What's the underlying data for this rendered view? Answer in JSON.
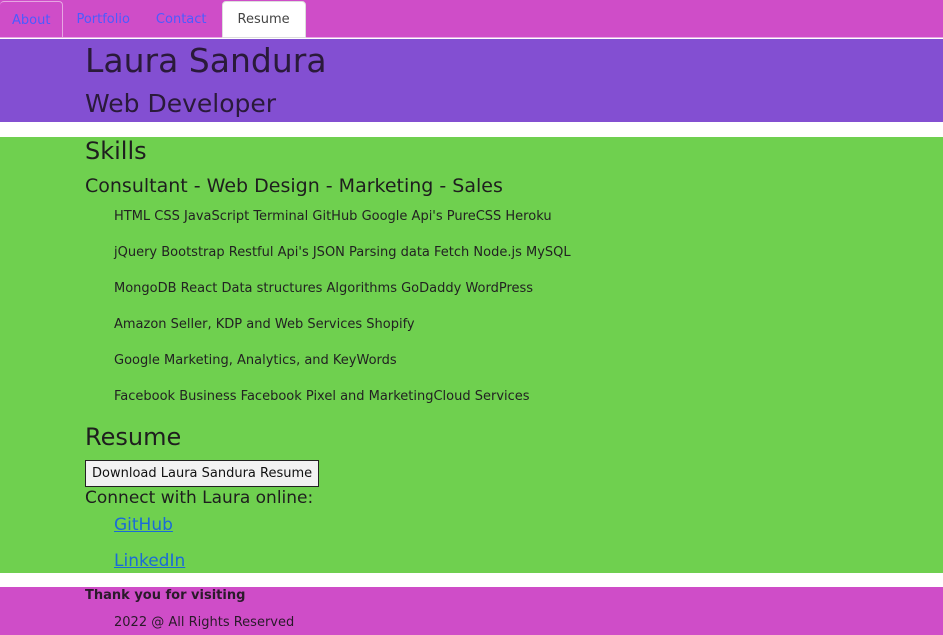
{
  "nav": {
    "tabs": [
      {
        "label": "About"
      },
      {
        "label": "Portfolio"
      },
      {
        "label": "Contact"
      },
      {
        "label": "Resume"
      }
    ],
    "active": "Resume"
  },
  "header": {
    "name": "Laura Sandura",
    "role": "Web Developer"
  },
  "skills": {
    "title": "Skills",
    "subtitle": "Consultant - Web Design - Marketing - Sales",
    "items": [
      "HTML CSS JavaScript Terminal GitHub Google Api's PureCSS Heroku",
      "jQuery Bootstrap Restful Api's JSON Parsing data Fetch Node.js MySQL",
      "MongoDB React Data structures Algorithms GoDaddy WordPress",
      "Amazon Seller, KDP and Web Services Shopify",
      "Google Marketing, Analytics, and KeyWords",
      "Facebook Business Facebook Pixel and MarketingCloud Services"
    ]
  },
  "resume": {
    "title": "Resume",
    "download_label": "Download Laura Sandura Resume"
  },
  "connect": {
    "title": "Connect with Laura online:",
    "links": [
      {
        "label": "GitHub"
      },
      {
        "label": "LinkedIn"
      }
    ]
  },
  "footer": {
    "thanks": "Thank you for visiting",
    "rights": "2022 @ All Rights Reserved"
  },
  "colors": {
    "nav_bg": "#cf4dc8",
    "header_bg": "#834fd2",
    "main_bg": "#6fd04f",
    "footer_bg": "#cf4dc8",
    "link": "#1a6ad8",
    "nav_link": "#4b5bff"
  }
}
